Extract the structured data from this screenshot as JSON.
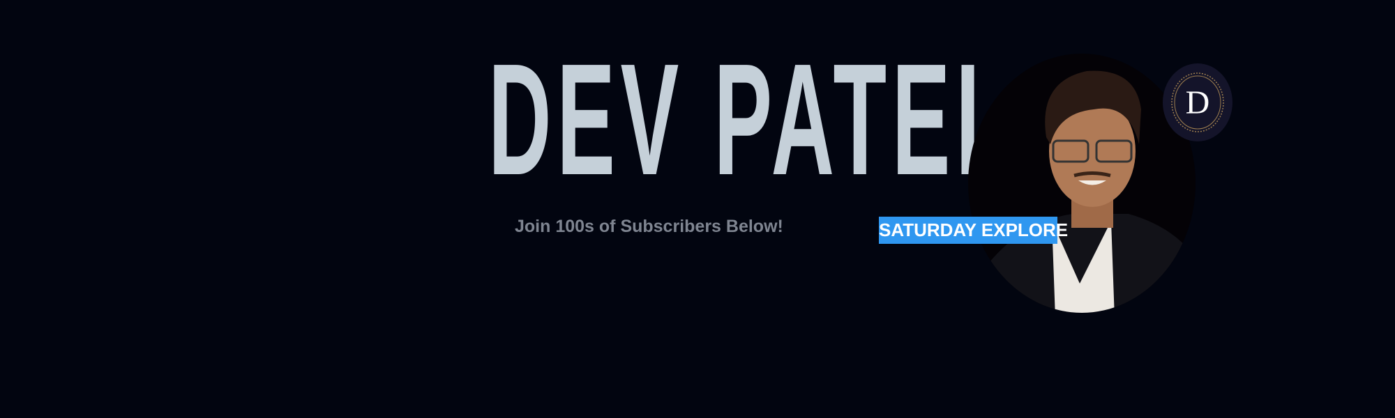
{
  "banner": {
    "title": "DEV PATEL",
    "subtitle": "Join 100s of Subscribers Below!",
    "badge": "SATURDAY EXPLORE",
    "logo_letter": "D"
  },
  "colors": {
    "background": "#020510",
    "title": "#c5d0d9",
    "subtitle": "#7f8591",
    "badge": "#2f97f0",
    "logo_bg": "#14142a",
    "logo_ring": "#a08050"
  },
  "icons": {
    "logo": "monogram-d-logo",
    "photo": "profile-portrait"
  }
}
